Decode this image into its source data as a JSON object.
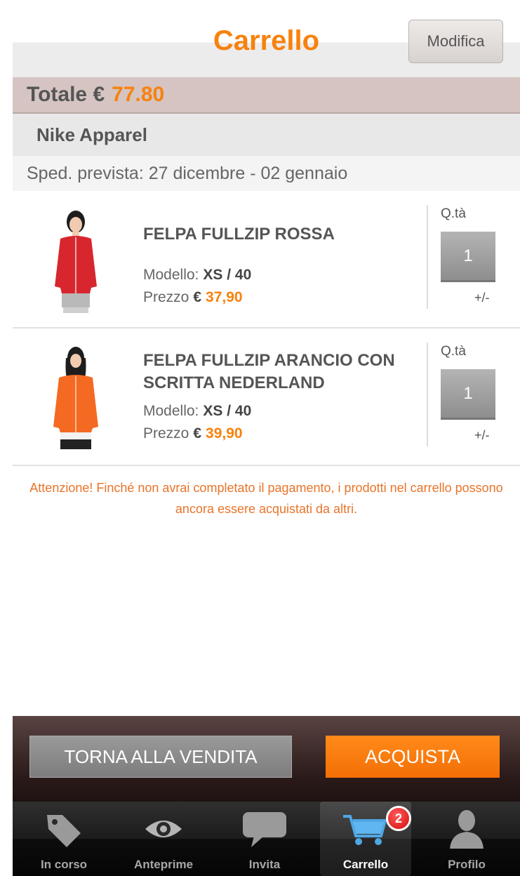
{
  "nav": {
    "title": "Carrello",
    "edit_label": "Modifica"
  },
  "total": {
    "label": "Totale €",
    "amount": "77.80"
  },
  "store": {
    "name": "Nike Apparel",
    "shipping": "Sped. prevista: 27 dicembre - 02 gennaio"
  },
  "items": [
    {
      "name": "FELPA FULLZIP ROSSA",
      "model_label": "Modello:",
      "model": "XS / 40",
      "price_label": "Prezzo",
      "currency": "€",
      "price": "37,90",
      "qty_label": "Q.tà",
      "qty": "1",
      "qty_toggle": "+/-",
      "image_color": "#d8262e"
    },
    {
      "name": "FELPA FULLZIP ARANCIO CON SCRITTA NEDERLAND",
      "model_label": "Modello:",
      "model": "XS / 40",
      "price_label": "Prezzo",
      "currency": "€",
      "price": "39,90",
      "qty_label": "Q.tà",
      "qty": "1",
      "qty_toggle": "+/-",
      "image_color": "#f46a22"
    }
  ],
  "warning": "Attenzione! Finché non avrai completato il pagamento, i prodotti nel carrello possono ancora essere acquistati da altri.",
  "actions": {
    "back_label": "TORNA ALLA VENDITA",
    "buy_label": "ACQUISTA"
  },
  "tabs": [
    {
      "label": "In corso",
      "icon": "tag-icon"
    },
    {
      "label": "Anteprime",
      "icon": "eye-icon"
    },
    {
      "label": "Invita",
      "icon": "speech-bubble-icon"
    },
    {
      "label": "Carrello",
      "icon": "cart-icon",
      "badge": "2",
      "active": true
    },
    {
      "label": "Profilo",
      "icon": "person-icon"
    }
  ],
  "colors": {
    "accent": "#f7820d",
    "total_bar": "#d5c4c2",
    "badge": "#d40c0c"
  }
}
